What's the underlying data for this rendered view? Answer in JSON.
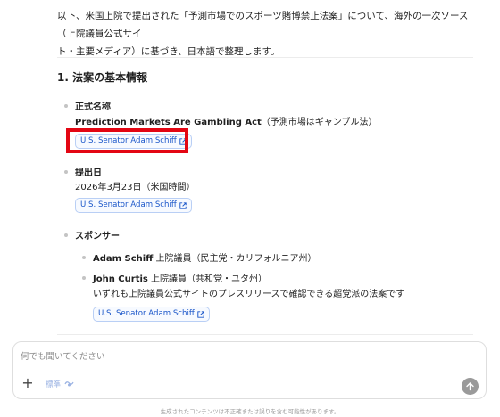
{
  "intro": {
    "line1": "以下、米国上院で提出された「予測市場でのスポーツ賭博禁止法案」について、海外の一次ソース（上院議員公式サイ",
    "line2": "ト・主要メディア）に基づき、日本語で整理します。"
  },
  "section": {
    "title": "1. 法案の基本情報",
    "items": [
      {
        "label": "正式名称",
        "value_bold": "Prediction Markets Are Gambling Act",
        "value_rest": "（予測市場はギャンブル法）",
        "source_chip": "U.S. Senator Adam Schiff"
      },
      {
        "label": "提出日",
        "value": "2026年3月23日（米国時間）",
        "source_chip": "U.S. Senator Adam Schiff"
      },
      {
        "label": "スポンサー",
        "sponsors": [
          {
            "name": "Adam Schiff",
            "detail": " 上院議員（民主党・カリフォルニア州）"
          },
          {
            "name": "John Curtis",
            "detail": " 上院議員（共和党・ユタ州）"
          }
        ],
        "note": "いずれも上院議員公式サイトのプレスリリースで確認できる超党派の法案です",
        "source_chip": "U.S. Senator Adam Schiff"
      }
    ]
  },
  "composer": {
    "placeholder": "何でも聞いてください",
    "mode_label": "標準"
  },
  "disclaimer": "生成されたコンテンツは不正確または誤りを含む可能性があります。",
  "colors": {
    "highlight": "#e30613",
    "chip_text": "#1a56c9",
    "chip_border": "#b9cff5"
  }
}
